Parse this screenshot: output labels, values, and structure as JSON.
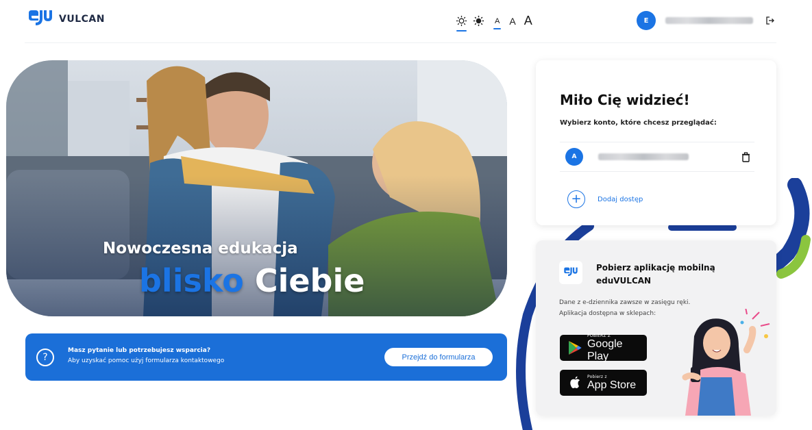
{
  "header": {
    "logo_text": "VULCAN",
    "logo_mark": "edu",
    "theme_light_icon": "sun-outline-icon",
    "theme_dark_icon": "sun-filled-icon",
    "font_sizes": [
      "A",
      "A",
      "A"
    ],
    "user_initial": "E",
    "logout_icon": "logout-icon"
  },
  "hero": {
    "title": "Nowoczesna edukacja",
    "subtitle_blue": "blisko",
    "subtitle_white": "Ciebie"
  },
  "help": {
    "icon": "question-icon",
    "line1": "Masz pytanie lub potrzebujesz wsparcia?",
    "line2": "Aby uzyskać pomoc użyj formularza kontaktowego",
    "button": "Przejdź do formularza"
  },
  "welcome": {
    "title": "Miło Cię widzieć!",
    "subtitle": "Wybierz konto, które chcesz przeglądać:",
    "account": {
      "initial": "A",
      "icon": "trash-icon"
    },
    "add_label": "Dodaj dostęp",
    "add_symbol": "+"
  },
  "app": {
    "logo_mark": "edu",
    "title": "Pobierz aplikację mobilną eduVULCAN",
    "desc1": "Dane z e-dziennika zawsze w zasięgu ręki.",
    "desc2": "Aplikacja dostępna w sklepach:",
    "google_small": "POBIERZ Z",
    "google_big": "Google Play",
    "apple_small": "Pobierz z",
    "apple_big": "App Store"
  },
  "colors": {
    "accent": "#1b74e4",
    "banner": "#1b6fd8",
    "dark_text": "#111111"
  }
}
